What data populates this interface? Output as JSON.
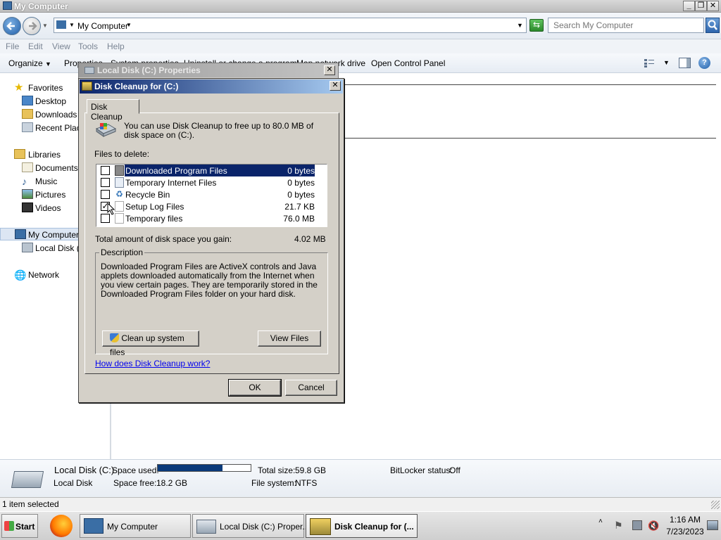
{
  "explorer": {
    "title": "My Computer",
    "address": "My Computer",
    "search_placeholder": "Search My Computer",
    "menu": [
      "File",
      "Edit",
      "View",
      "Tools",
      "Help"
    ],
    "commands": {
      "organize": "Organize",
      "properties": "Properties",
      "system_properties": "System properties",
      "uninstall": "Uninstall or change a program",
      "map_drive": "Map network drive",
      "control_panel": "Open Control Panel"
    },
    "nav": {
      "favorites": "Favorites",
      "desktop": "Desktop",
      "downloads": "Downloads",
      "recent": "Recent Places",
      "libraries": "Libraries",
      "documents": "Documents",
      "music": "Music",
      "pictures": "Pictures",
      "videos": "Videos",
      "computer": "My Computer",
      "local_disk": "Local Disk (C:)",
      "network": "Network"
    },
    "details": {
      "name": "Local Disk (C:)",
      "type": "Local Disk",
      "space_used_label": "Space used:",
      "space_used_fraction": 0.7,
      "space_free_label": "Space free:",
      "space_free": "18.2 GB",
      "total_size_label": "Total size:",
      "total_size": "59.8 GB",
      "file_system_label": "File system:",
      "file_system": "NTFS",
      "bitlocker_label": "BitLocker status:",
      "bitlocker": "Off"
    },
    "status": "1 item selected"
  },
  "properties_dialog": {
    "title": "Local Disk (C:) Properties"
  },
  "cleanup": {
    "title": "Disk Cleanup for  (C:)",
    "tab": "Disk Cleanup",
    "intro": "You can use Disk Cleanup to free up to 80.0 MB of disk space on  (C:).",
    "files_label": "Files to delete:",
    "files": [
      {
        "name": "Downloaded Program Files",
        "size": "0 bytes",
        "checked": false,
        "selected": true
      },
      {
        "name": "Temporary Internet Files",
        "size": "0 bytes",
        "checked": false,
        "selected": false
      },
      {
        "name": "Recycle Bin",
        "size": "0 bytes",
        "checked": false,
        "selected": false
      },
      {
        "name": "Setup Log Files",
        "size": "21.7 KB",
        "checked": true,
        "selected": false
      },
      {
        "name": "Temporary files",
        "size": "76.0 MB",
        "checked": false,
        "selected": false
      }
    ],
    "total_label": "Total amount of disk space you gain:",
    "total_value": "4.02 MB",
    "description_label": "Description",
    "description": "Downloaded Program Files are ActiveX controls and Java applets downloaded automatically from the Internet when you view certain pages. They are temporarily stored in the Downloaded Program Files folder on your hard disk.",
    "clean_system_button": "Clean up system files",
    "view_files_button": "View Files",
    "help_link": "How does Disk Cleanup work?",
    "ok_button": "OK",
    "cancel_button": "Cancel"
  },
  "taskbar": {
    "start": "Start",
    "items": [
      "My Computer",
      "Local Disk (C:) Proper...",
      "Disk Cleanup for  (..."
    ],
    "time": "1:16 AM",
    "date": "7/23/2023"
  }
}
